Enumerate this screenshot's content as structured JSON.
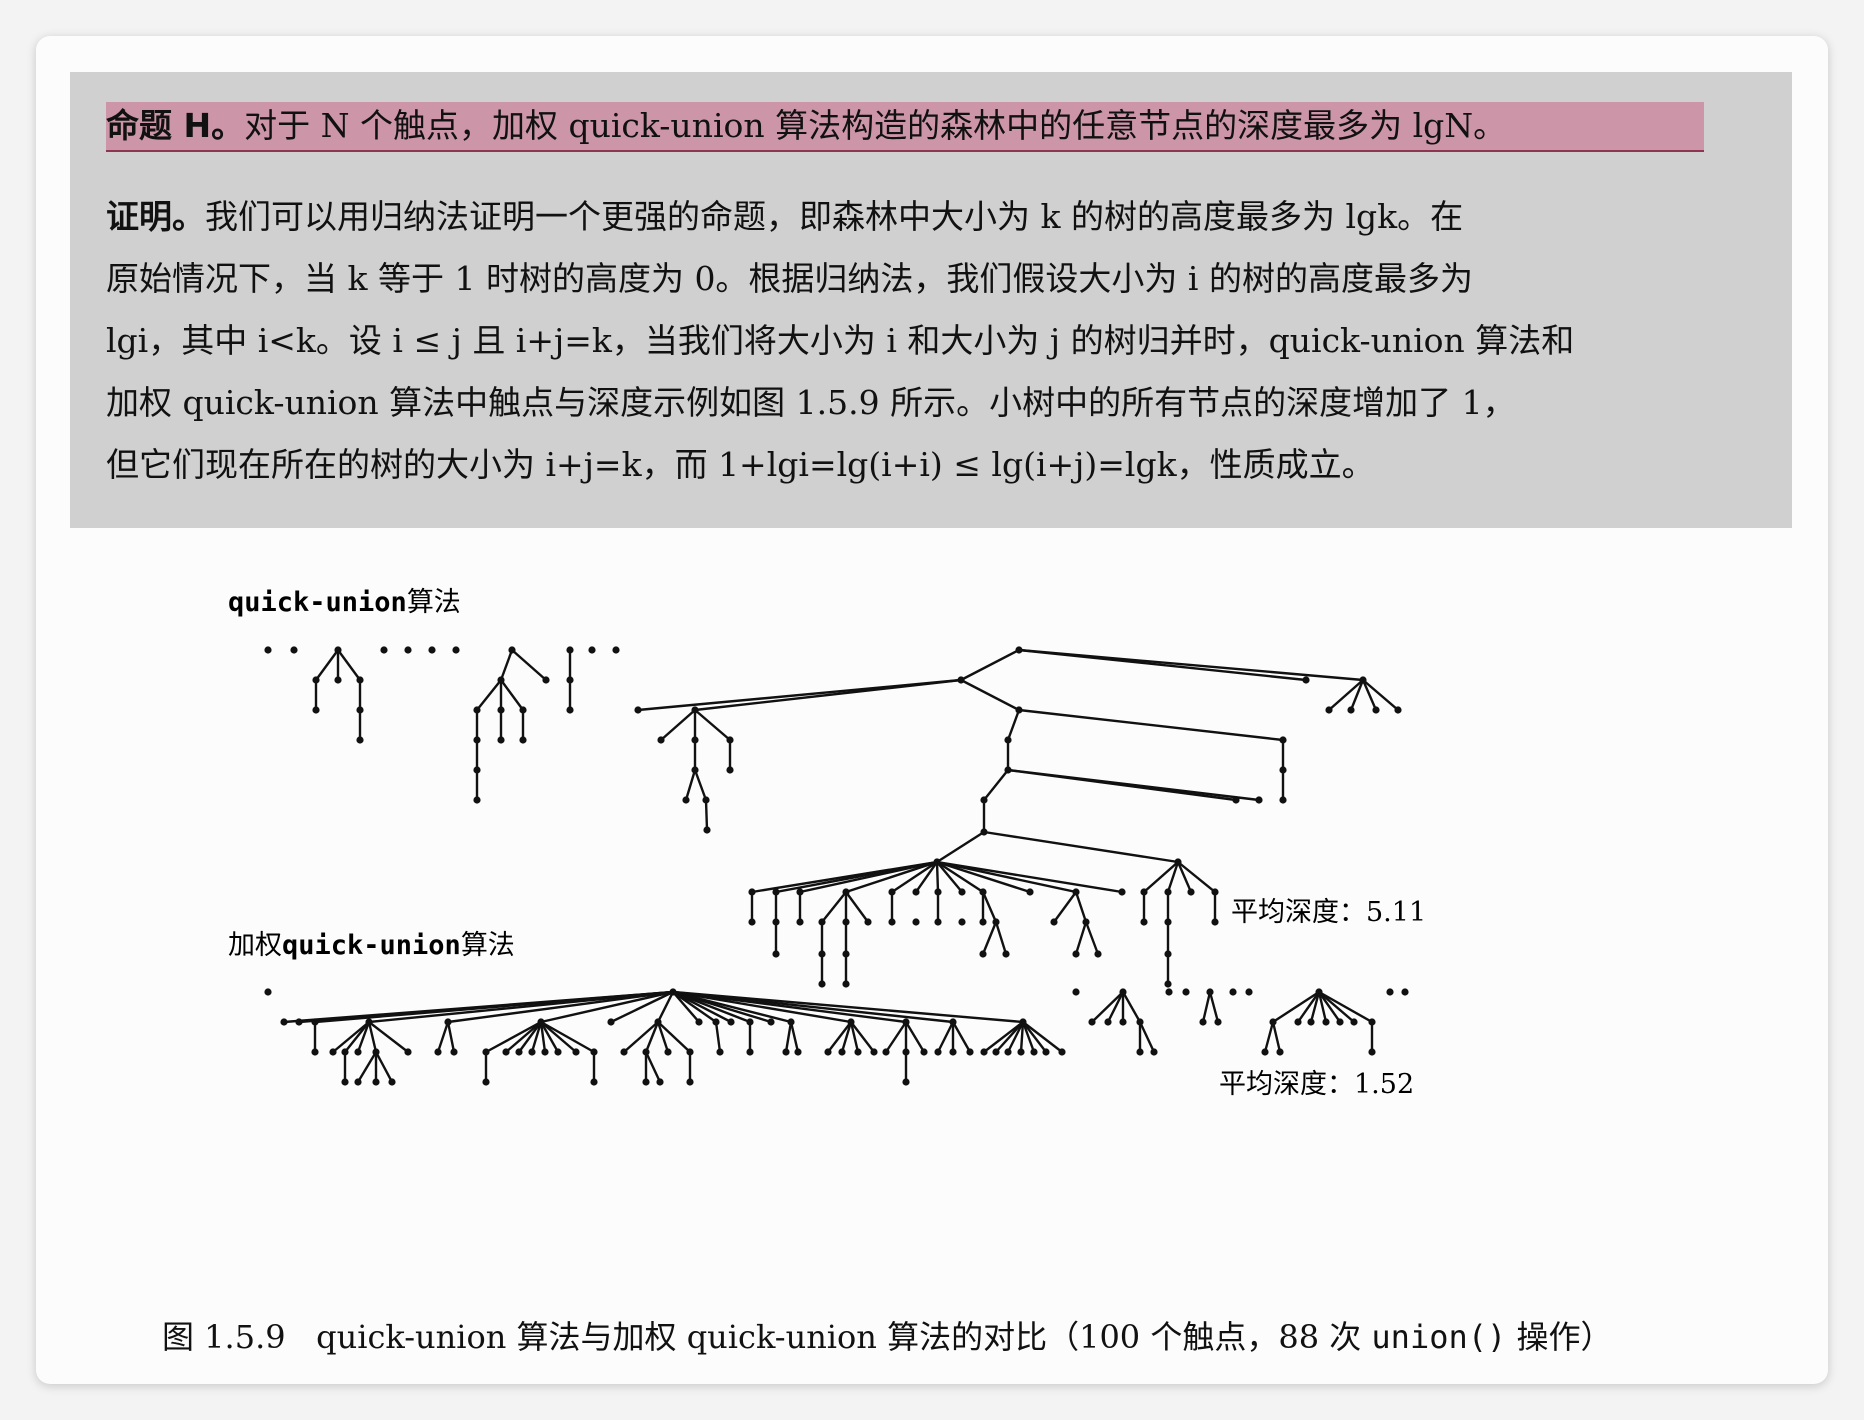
{
  "proposition": {
    "label": "命题 H。",
    "text": "对于 N 个触点，加权 quick-union 算法构造的森林中的任意节点的深度最多为 lgN。"
  },
  "proof": {
    "label": "证明。",
    "lines": [
      "我们可以用归纳法证明一个更强的命题，即森林中大小为 k 的树的高度最多为 lgk。在",
      "原始情况下，当 k 等于 1 时树的高度为 0。根据归纳法，我们假设大小为 i 的树的高度最多为",
      "lgi，其中 i<k。设 i ≤ j 且 i+j=k，当我们将大小为 i 和大小为 j 的树归并时，quick-union 算法和",
      "加权 quick-union 算法中触点与深度示例如图 1.5.9 所示。小树中的所有节点的深度增加了 1，",
      "但它们现在所在的树的大小为 i+j=k，而 1+lgi=lg(i+i) ≤ lg(i+j)=lgk，性质成立。"
    ]
  },
  "figure": {
    "quick_union": {
      "label_code": "quick-union",
      "label_cn": "算法",
      "avg_depth": "平均深度：5.11"
    },
    "weighted": {
      "label_prefix": "加权",
      "label_code": "quick-union",
      "label_cn": "算法",
      "avg_depth": "平均深度：1.52"
    },
    "caption": {
      "number": "图 1.5.9",
      "text_a": "quick-union 算法与加权 quick-union 算法的对比（100 个触点，88 次 ",
      "code": "union()",
      "text_b": " 操作）"
    }
  },
  "colors": {
    "highlight": "#cc96a8",
    "box": "#d0d0d0",
    "ink": "#111111"
  }
}
